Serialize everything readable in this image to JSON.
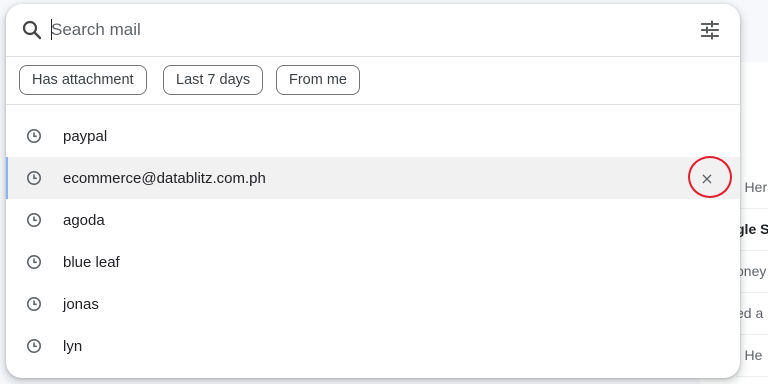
{
  "search": {
    "placeholder": "Search mail",
    "value": ""
  },
  "chips": [
    {
      "label": "Has attachment"
    },
    {
      "label": "Last 7 days"
    },
    {
      "label": "From me"
    }
  ],
  "suggestions": [
    {
      "label": "paypal",
      "icon": "clock-icon"
    },
    {
      "label": "ecommerce@datablitz.com.ph",
      "icon": "clock-icon",
      "highlighted": true,
      "remove_label": "×"
    },
    {
      "label": "agoda",
      "icon": "clock-icon"
    },
    {
      "label": "blue leaf",
      "icon": "clock-icon"
    },
    {
      "label": "jonas",
      "icon": "clock-icon"
    },
    {
      "label": "lyn",
      "icon": "clock-icon"
    }
  ],
  "background_rows": [
    {
      "text": "- Her"
    },
    {
      "text": "gle S",
      "bold": true
    },
    {
      "text": "oney"
    },
    {
      "text": "ed a"
    },
    {
      "text": "- He"
    }
  ],
  "colors": {
    "highlight_ring": "#e01e2c",
    "active_row_bg": "#f1f1f1",
    "active_row_accent": "#8ab4f8"
  }
}
